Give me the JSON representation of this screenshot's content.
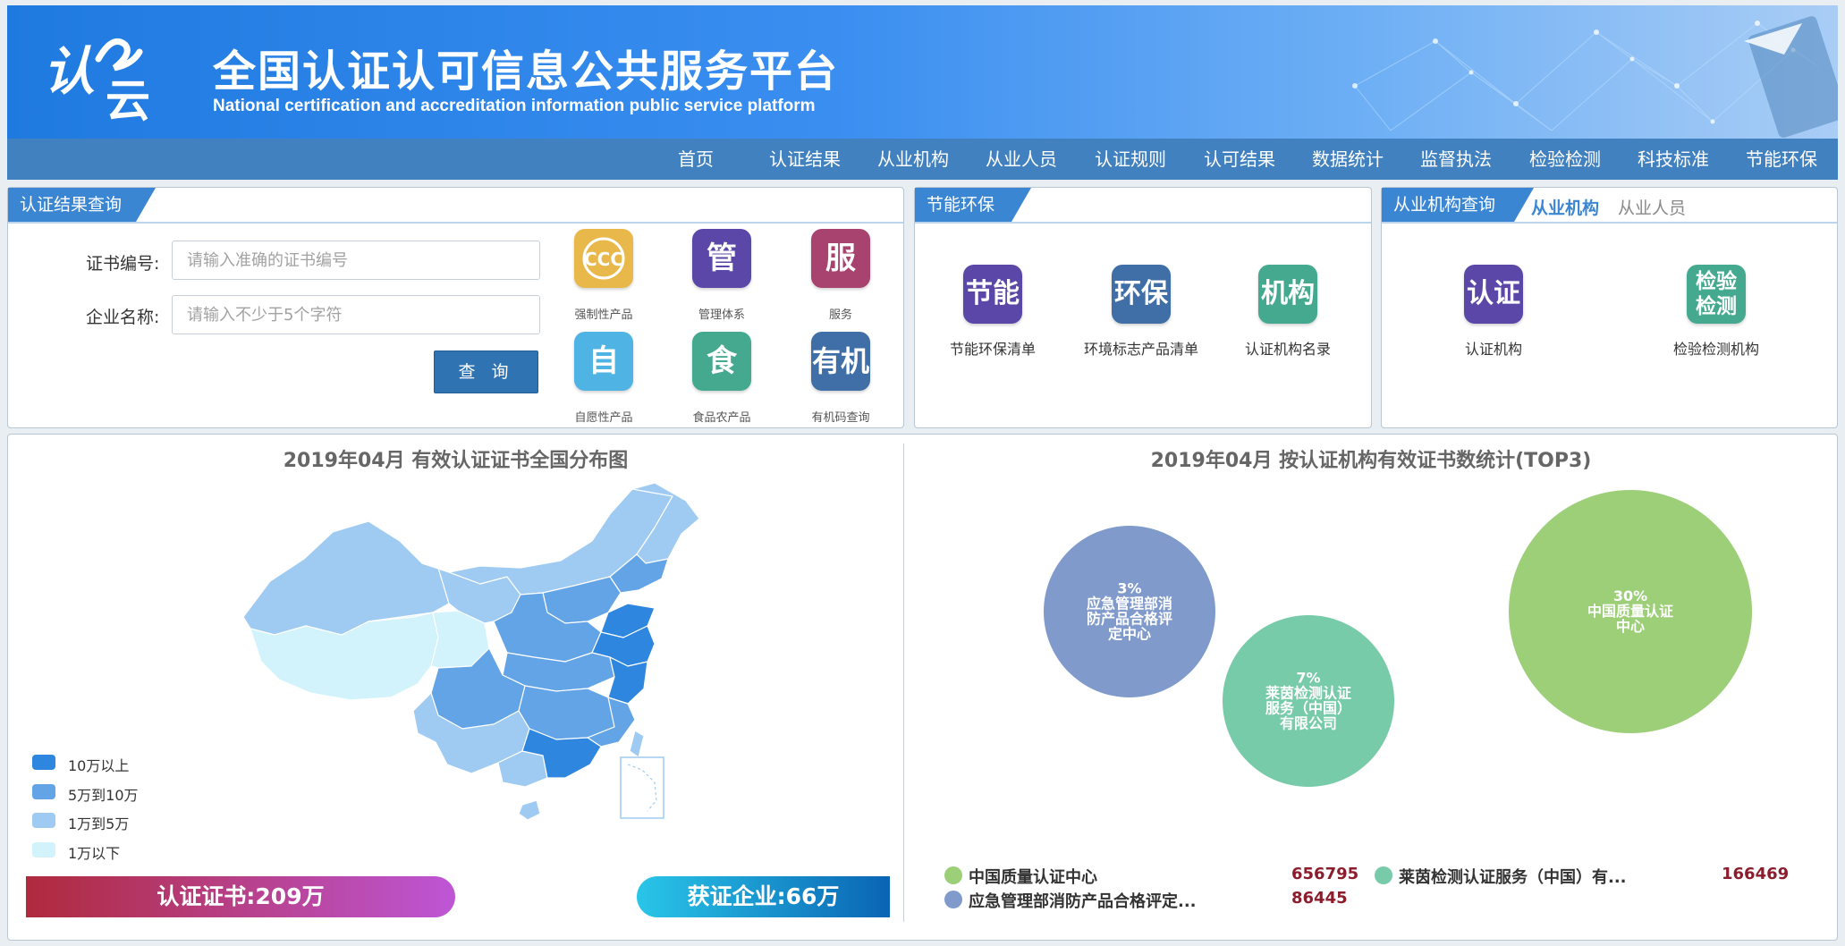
{
  "header": {
    "logo_text": "认云",
    "title_cn": "全国认证认可信息公共服务平台",
    "title_en": "National certification and accreditation information public service platform"
  },
  "nav": {
    "items": [
      "首页",
      "认证结果",
      "从业机构",
      "从业人员",
      "认证规则",
      "认可结果",
      "数据统计",
      "监督执法",
      "检验检测",
      "科技标准",
      "节能环保"
    ]
  },
  "cert_query": {
    "tab": "认证结果查询",
    "cert_no_label": "证书编号:",
    "cert_no_placeholder": "请输入准确的证书编号",
    "company_label": "企业名称:",
    "company_placeholder": "请输入不少于5个字符",
    "query_button": "查 询",
    "tiles": [
      {
        "glyph": "CCC",
        "label": "强制性产品",
        "color": "#e8b84a",
        "icon": "ccc-mark-icon"
      },
      {
        "glyph": "管",
        "label": "管理体系",
        "color": "#5a47a8",
        "icon": "management-icon"
      },
      {
        "glyph": "服",
        "label": "服务",
        "color": "#a8426e",
        "icon": "service-icon"
      },
      {
        "glyph": "自",
        "label": "自愿性产品",
        "color": "#4fb3e3",
        "icon": "voluntary-icon"
      },
      {
        "glyph": "食",
        "label": "食品农产品",
        "color": "#45a98f",
        "icon": "food-icon"
      },
      {
        "glyph": "有机",
        "label": "有机码查询",
        "color": "#3f6fa6",
        "icon": "organic-icon"
      }
    ]
  },
  "energy": {
    "tab": "节能环保",
    "tiles": [
      {
        "glyph": "节能",
        "label": "节能环保清单",
        "color": "#5a47a8",
        "icon": "energy-saving-icon"
      },
      {
        "glyph": "环保",
        "label": "环境标志产品清单",
        "color": "#3f6fa6",
        "icon": "environment-icon"
      },
      {
        "glyph": "机构",
        "label": "认证机构名录",
        "color": "#45a98f",
        "icon": "institution-icon"
      }
    ]
  },
  "org_query": {
    "tab": "从业机构查询",
    "subtab_active": "从业机构",
    "subtab_inactive": "从业人员",
    "tiles": [
      {
        "glyph": "认证",
        "label": "认证机构",
        "color": "#5a47a8",
        "icon": "certification-org-icon"
      },
      {
        "glyph": "检验\n检测",
        "label": "检验检测机构",
        "color": "#45a98f",
        "icon": "inspection-org-icon"
      }
    ]
  },
  "map_section": {
    "title": "2019年04月  有效认证证书全国分布图",
    "legend": [
      {
        "label": "10万以上",
        "color": "#2e86de"
      },
      {
        "label": "5万到10万",
        "color": "#63a4e6"
      },
      {
        "label": "1万到5万",
        "color": "#9fcbf2"
      },
      {
        "label": "1万以下",
        "color": "#d2f3fb"
      }
    ],
    "cert_total": "认证证书:209万",
    "company_total": "获证企业:66万"
  },
  "chart_data": {
    "type": "bubble",
    "title": "2019年04月   按认证机构有效证书数统计(TOP3)",
    "series": [
      {
        "name": "中国质量认证中心",
        "percent": "30%",
        "label_lines": [
          "中国质量认证",
          "中心"
        ],
        "value": 656795,
        "color": "#9ccf78"
      },
      {
        "name": "莱茵检测认证服务（中国）有...",
        "percent": "7%",
        "label_lines": [
          "莱茵检测认证",
          "服务（中国）",
          "有限公司"
        ],
        "value": 166469,
        "color": "#78cba9"
      },
      {
        "name": "应急管理部消防产品合格评定...",
        "percent": "3%",
        "label_lines": [
          "应急管理部消",
          "防产品合格评",
          "定中心"
        ],
        "value": 86445,
        "color": "#7f9acb"
      }
    ],
    "legend_values": [
      "656795",
      "166469",
      "86445"
    ]
  }
}
